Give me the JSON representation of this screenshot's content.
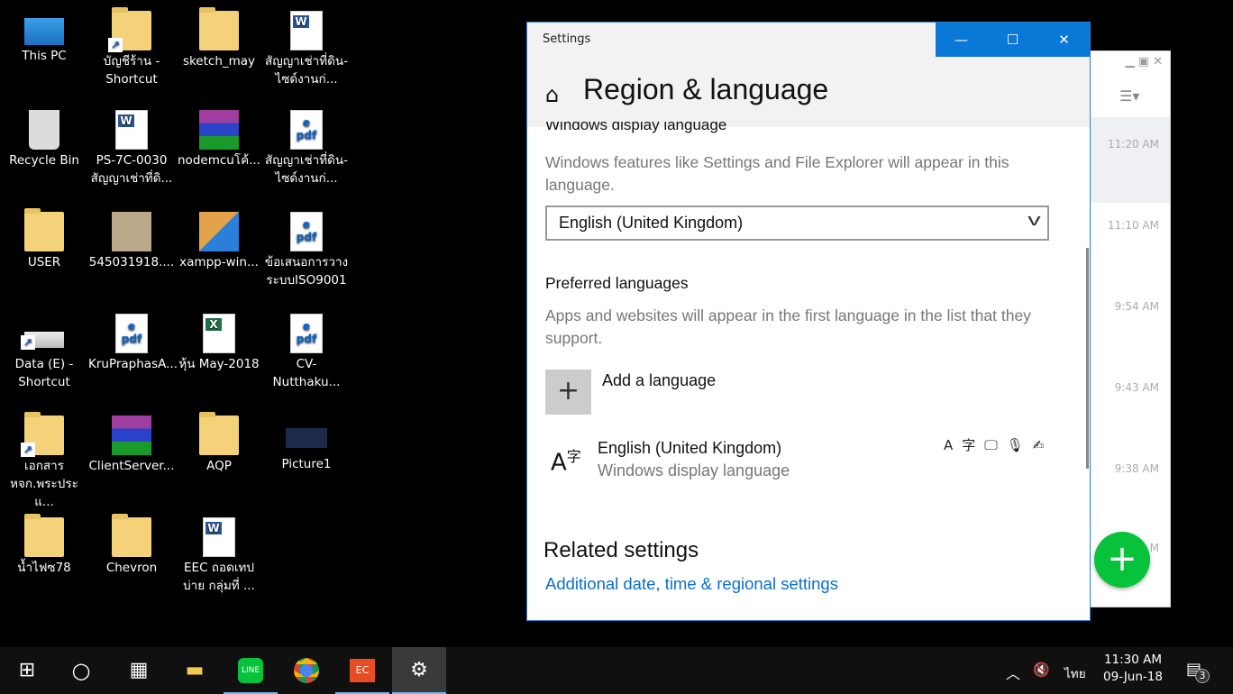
{
  "desktop": {
    "icons": [
      {
        "label": "This PC",
        "type": "pc"
      },
      {
        "label": "บัญชีร้าน - Shortcut",
        "type": "folder-shortcut"
      },
      {
        "label": "sketch_may",
        "type": "folder"
      },
      {
        "label": "สัญญาเช่าที่ดิน-ไซด์งานก่...",
        "type": "word"
      },
      {
        "label": "Recycle Bin",
        "type": "bin"
      },
      {
        "label": "PS-7C-0030 สัญญาเช่าที่ดิ...",
        "type": "word"
      },
      {
        "label": "nodemcuโค้...",
        "type": "rar"
      },
      {
        "label": "สัญญาเช่าที่ดิน-ไซด์งานก่...",
        "type": "pdf"
      },
      {
        "label": "USER",
        "type": "folder"
      },
      {
        "label": "545031918....",
        "type": "photo"
      },
      {
        "label": "xampp-win...",
        "type": "installer"
      },
      {
        "label": "ข้อเสนอการวางระบบISO9001",
        "type": "pdf"
      },
      {
        "label": "Data (E) - Shortcut",
        "type": "drive-shortcut"
      },
      {
        "label": "KruPraphasA...",
        "type": "pdf"
      },
      {
        "label": "หุ้น May-2018",
        "type": "excel"
      },
      {
        "label": "CV-Nutthaku...",
        "type": "pdf"
      },
      {
        "label": "เอกสาร หจก.พระประแ...",
        "type": "folder-shortcut"
      },
      {
        "label": "ClientServer...",
        "type": "rar"
      },
      {
        "label": "AQP",
        "type": "folder"
      },
      {
        "label": "Picture1",
        "type": "picture"
      },
      {
        "label": "น้ำไฟซ78",
        "type": "folder"
      },
      {
        "label": "Chevron",
        "type": "folder"
      },
      {
        "label": "EEC ถอดเทปบ่าย กลุ่มที่ ...",
        "type": "word"
      }
    ]
  },
  "settings": {
    "window_title": "Settings",
    "minimize": "—",
    "maximize": "☐",
    "close": "✕",
    "page_title": "Region & language",
    "home_icon": "⌂",
    "display_language_heading": "Windows display language",
    "display_language_desc": "Windows features like Settings and File Explorer will appear in this language.",
    "display_language_value": "English (United Kingdom)",
    "preferred_heading": "Preferred languages",
    "preferred_desc": "Apps and websites will appear in the first language in the list that they support.",
    "add_language": "Add a language",
    "languages": [
      {
        "name": "English (United Kingdom)",
        "sub": "Windows display language"
      }
    ],
    "related_heading": "Related settings",
    "related_link": "Additional date, time & regional settings"
  },
  "line_app": {
    "times": [
      "11:20 AM",
      "11:10 AM",
      "9:54 AM",
      "9:43 AM",
      "9:38 AM",
      "M"
    ],
    "accent": "#06c33b"
  },
  "taskbar": {
    "time": "11:30 AM",
    "date": "09-Jun-18",
    "input_lang": "ไทย",
    "notification_count": "3",
    "accent": "#0a78d7"
  }
}
